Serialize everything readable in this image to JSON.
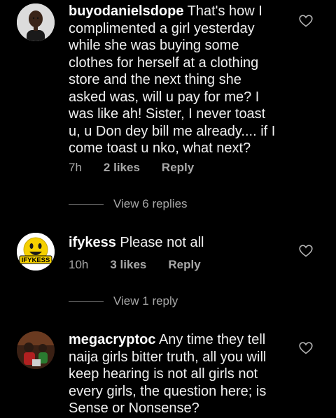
{
  "comments": [
    {
      "username": "buyodanielsdope",
      "text": " That's how I complimented a girl yesterday while she was buying some clothes for herself at a clothing store and the next thing she asked was, will u pay for me? I was like ah! Sister, I never toast u, u Don dey bill me already.... if I come toast u nko, what next?",
      "time": "7h",
      "likes": "2 likes",
      "reply": "Reply",
      "view_replies": "View 6 replies",
      "avatar_icon": "profile-photo",
      "colors": {
        "avatar_bg": "#d8d8d8"
      }
    },
    {
      "username": "ifykess",
      "text": " Please not all",
      "time": "10h",
      "likes": "3 likes",
      "reply": "Reply",
      "view_replies": "View 1 reply",
      "avatar_icon": "smiley-face-logo",
      "avatar_logo_text": "IFYKESS",
      "colors": {
        "avatar_bg": "#ffffff",
        "logo_yellow": "#f5d000"
      }
    },
    {
      "username": "megacryptoc",
      "text": " Any time they tell naija girls bitter truth, all you will keep hearing is not all girls not every girls, the question here; is Sense or Nonsense?",
      "avatar_icon": "profile-photo",
      "colors": {
        "avatar_bg": "#2a1810"
      }
    }
  ],
  "colors": {
    "background": "#000000",
    "text": "#f0f0f0",
    "secondary": "#a8a8a8"
  }
}
